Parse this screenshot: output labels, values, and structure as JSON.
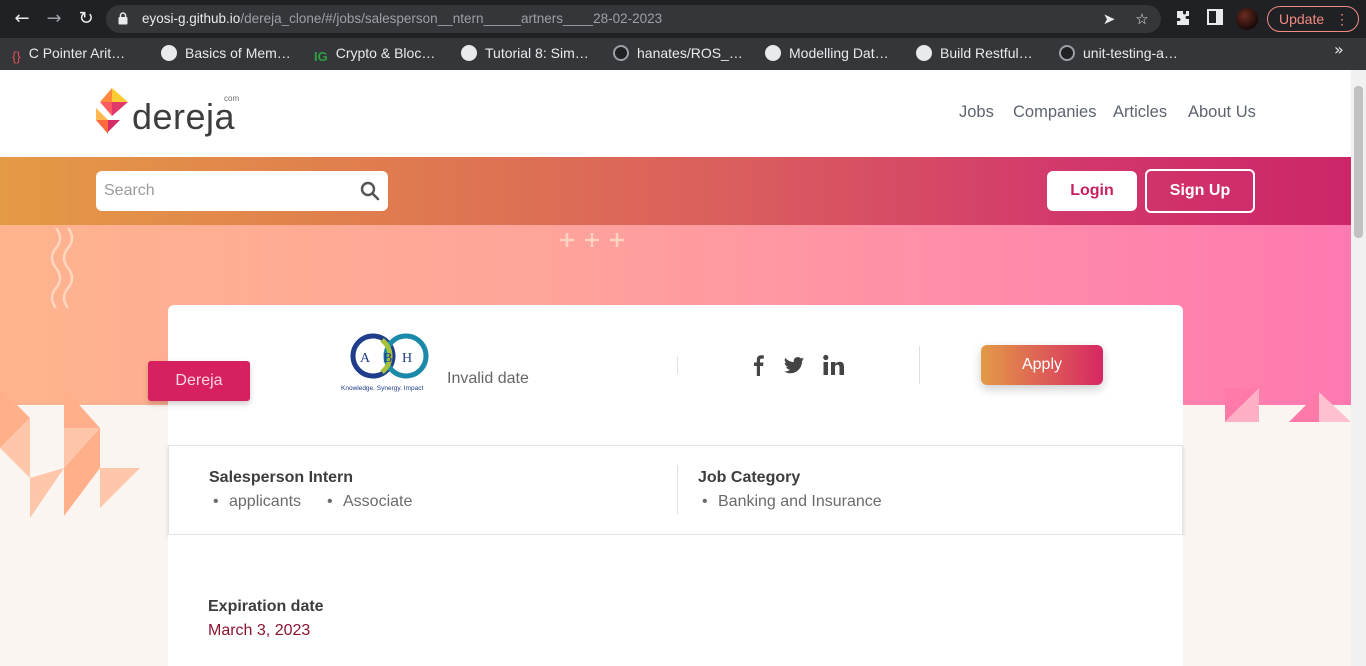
{
  "browser": {
    "url_host": "eyosi-g.github.io",
    "url_path": "/dereja_clone/#/jobs/salesperson__ntern_____artners____28-02-2023",
    "update_label": "Update",
    "bookmarks": [
      {
        "label": "C Pointer Arit…",
        "icon": "code-icon"
      },
      {
        "label": "Basics of Mem…",
        "icon": "globe-icon"
      },
      {
        "label": "Crypto & Bloc…",
        "icon": "ig-icon"
      },
      {
        "label": "Tutorial 8: Sim…",
        "icon": "globe-icon"
      },
      {
        "label": "hanates/ROS_…",
        "icon": "github-icon"
      },
      {
        "label": "Modelling Dat…",
        "icon": "globe-icon"
      },
      {
        "label": "Build Restful…",
        "icon": "globe-icon"
      },
      {
        "label": "unit-testing-a…",
        "icon": "github-icon"
      }
    ]
  },
  "site": {
    "logo_text": "dereja",
    "logo_suffix": "com",
    "nav": [
      "Jobs",
      "Companies",
      "Articles",
      "About Us"
    ],
    "search_placeholder": "Search",
    "login_label": "Login",
    "signup_label": "Sign Up",
    "accent": "#d6205f"
  },
  "job": {
    "company_tag": "Dereja",
    "post_date": "Invalid date",
    "apply_label": "Apply",
    "title": "Salesperson Intern",
    "title_items": [
      "applicants",
      "Associate"
    ],
    "category_title": "Job Category",
    "category_items": [
      "Banking and Insurance"
    ],
    "expiration_label": "Expiration date",
    "expiration_value": "March 3, 2023"
  }
}
